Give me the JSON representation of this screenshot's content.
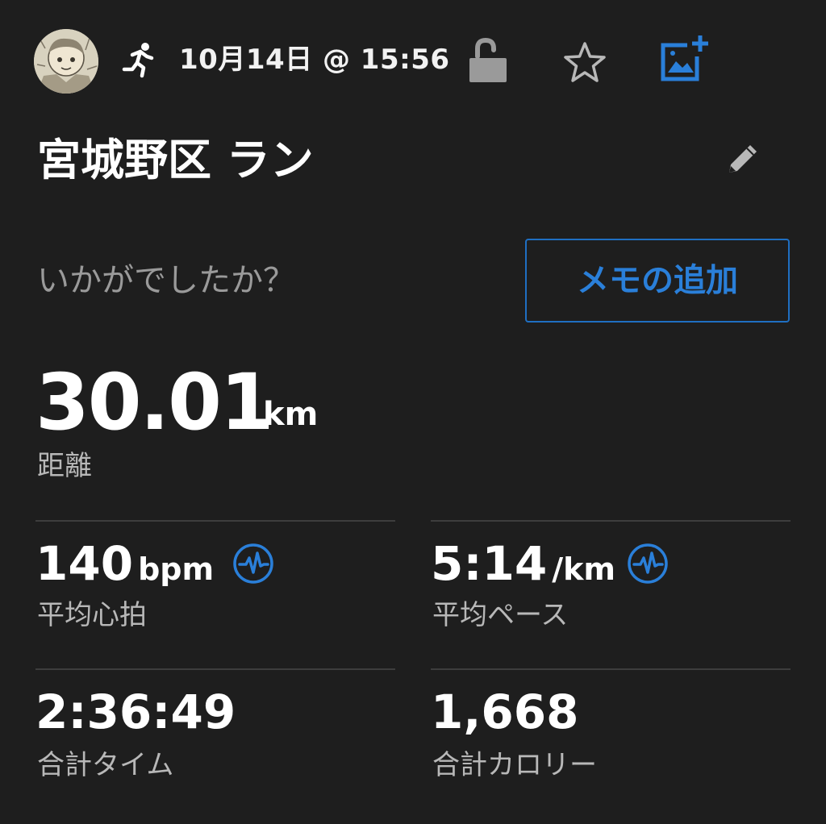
{
  "header": {
    "datetime": "10月14日 @ 15:56",
    "icons": [
      "avatar",
      "runner-icon",
      "lock-open-icon",
      "star-icon",
      "add-photo-icon"
    ]
  },
  "activity": {
    "title": "宮城野区 ラン",
    "prompt": "いかがでしたか？",
    "memo_button_label": "メモの追加"
  },
  "distance": {
    "value": "30.01",
    "unit": "km",
    "label": "距離"
  },
  "stats": {
    "heart_rate": {
      "value": "140",
      "unit": "bpm",
      "label": "平均心拍"
    },
    "pace": {
      "value": "5:14",
      "unit": "/km",
      "label": "平均ペース"
    },
    "time": {
      "value": "2:36:49",
      "label": "合計タイム"
    },
    "calories": {
      "value": "1,668",
      "label": "合計カロリー"
    }
  },
  "colors": {
    "background": "#1e1e1e",
    "accent_blue": "#2a7fd9",
    "icon_grey": "#9a9a9a",
    "label_grey": "#b8b8b8"
  }
}
